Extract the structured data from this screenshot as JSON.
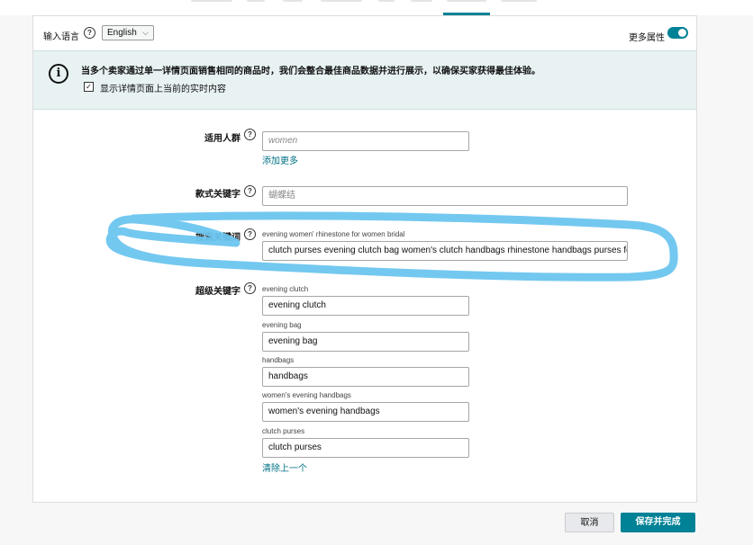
{
  "header": {
    "lang_label": "输入语言",
    "lang_value": "English",
    "more_attrs_label": "更多属性",
    "more_attrs_on": true
  },
  "info": {
    "text": "当多个卖家通过单一详情页面销售相同的商品时，我们会整合最佳商品数据并进行展示，以确保买家获得最佳体验。",
    "checkbox_label": "显示详情页面上当前的实时内容",
    "checkbox_checked": true
  },
  "form": {
    "audience": {
      "label": "适用人群",
      "placeholder": "women",
      "add_more": "添加更多"
    },
    "style_keywords": {
      "label": "款式关键字",
      "value": "蝴蝶结"
    },
    "search_terms": {
      "label": "搜索关键词",
      "hint": "evening women' rhinestone for women bridal",
      "value": "clutch purses evening clutch bag women's clutch handbags rhinestone handbags purses for wo"
    },
    "platinum_keywords": {
      "label": "超级关键字",
      "items": [
        {
          "hint": "evening clutch",
          "value": "evening clutch"
        },
        {
          "hint": "evening bag",
          "value": "evening bag"
        },
        {
          "hint": "handbags",
          "value": "handbags"
        },
        {
          "hint": "women's evening handbags",
          "value": "women's evening handbags"
        },
        {
          "hint": "clutch purses",
          "value": "clutch purses"
        }
      ],
      "remove_last": "清除上一个"
    }
  },
  "actions": {
    "cancel": "取消",
    "save": "保存并完成"
  },
  "colors": {
    "accent": "#008296",
    "scribble": "#6cc5ef",
    "link": "#007185"
  }
}
